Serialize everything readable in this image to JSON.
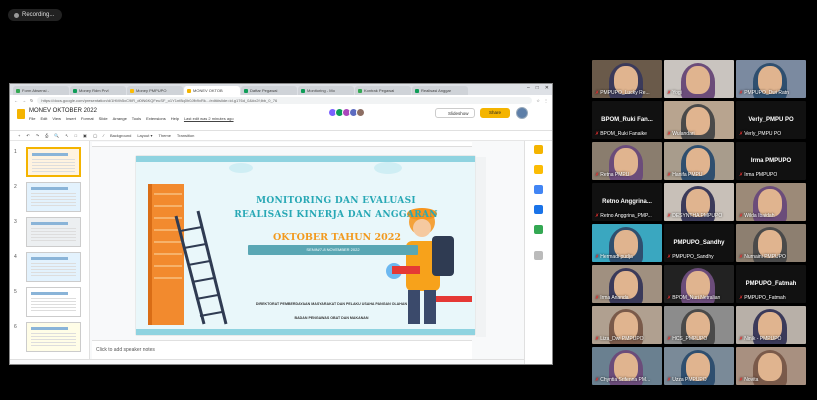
{
  "recording": {
    "label": "Recording..."
  },
  "browser": {
    "tabs": [
      {
        "label": "Form Absensi -",
        "color": "#34a853"
      },
      {
        "label": "Money Rdm Prvl",
        "color": "#0f9d58"
      },
      {
        "label": "Money PMPUPO",
        "color": "#fbbc04"
      },
      {
        "label": "MONEV OKTOB",
        "color": "#f4b400",
        "active": true
      },
      {
        "label": "Daftar Pegawai",
        "color": "#0f9d58"
      },
      {
        "label": "Monitoring - Mo",
        "color": "#0f9d58"
      },
      {
        "label": "Kontrak Pegawai",
        "color": "#34a853"
      },
      {
        "label": "Realisasi Anggar",
        "color": "#0f9d58"
      }
    ],
    "url": "https://docs.google.com/presentation/d/1HMh5xC9iR_d0lN6KQFeuSF_o1Y1nf8q0h0Jfb9xRk.../edit#slide=id.g176d_0&#x2f;lbb_0_76"
  },
  "slides_app": {
    "doc_title": "MONEV OKTOBER 2022",
    "menu": [
      "File",
      "Edit",
      "View",
      "Insert",
      "Format",
      "Slide",
      "Arrange",
      "Tools",
      "Extensions",
      "Help"
    ],
    "last_edit": "Last edit was 2 minutes ago",
    "slideshow_label": "Slideshow",
    "share_label": "Share",
    "toolbar_items": [
      "Background",
      "Layout ▾",
      "Theme",
      "Transition"
    ],
    "thumbs": [
      "1",
      "2",
      "3",
      "4",
      "5",
      "6"
    ],
    "notes_placeholder": "Click to add speaker notes"
  },
  "slide": {
    "title_line1": "MONITORING DAN EVALUASI",
    "title_line2": "REALISASI KINERJA DAN ANGGARAN",
    "month": "OKTOBER TAHUN 2022",
    "date": "SENIN/7-8 NOVEMBER 2022",
    "org": "DIREKTORAT PEMBERDAYAAN MASYARAKAT DAN PELAKU USAHA PANGAN OLAHAN",
    "agency": "BADAN PENGAWAS OBAT DAN MAKANAN"
  },
  "participants": [
    {
      "name": "PMPUPO_Lucky Re..."
    },
    {
      "name": "Yogi"
    },
    {
      "name": "PMPUPO_Dwi Ratn"
    },
    {
      "name": "BPOM_Ruki Fan...",
      "big": "BPOM_Ruki Fan...",
      "label": "BPOM_Ruki Fanaike"
    },
    {
      "name": "Wulandari"
    },
    {
      "name": "Verly_PMPU PO",
      "big": "Verly_PMPU PO",
      "label": "Verly_PMPU PO"
    },
    {
      "name": "Retna PMPU"
    },
    {
      "name": "Hanifa PMPU"
    },
    {
      "name": "Irma PMPUPO",
      "big": "Irma PMPUPO",
      "label": "Irma PMPUPO"
    },
    {
      "name": "Retno Anggrina...",
      "big": "Retno Anggrina...",
      "label": "Retno Anggrina_PMP..."
    },
    {
      "name": "DESYNTHA PMPUPO"
    },
    {
      "name": "Wilda Ibaidah"
    },
    {
      "name": "Hermadi pudja"
    },
    {
      "name": "PMPUPO_Sandhy",
      "big": "PMPUPO_Sandhy",
      "label": "PMPUPO_Sandhy"
    },
    {
      "name": "Nurnaini PMPUPO"
    },
    {
      "name": "Irma Ananda"
    },
    {
      "name": "BPOM_Nuri Netralian"
    },
    {
      "name": "PMPUPO_Fatmah",
      "big": "PMPUPO_Fatmah",
      "label": "PMPUPO_Fatmah"
    },
    {
      "name": "Liza_Dwi PMPUPO"
    },
    {
      "name": "HCS_PMPUPO"
    },
    {
      "name": "Ninik - PMPUPO"
    },
    {
      "name": "Chyntia Srifenna PM..."
    },
    {
      "name": "Uzza PMPUPO"
    },
    {
      "name": "Novita"
    }
  ],
  "colors": {
    "accent": "#f4b400",
    "slide_teal": "#28a8b5",
    "slide_orange": "#f29a1e"
  }
}
